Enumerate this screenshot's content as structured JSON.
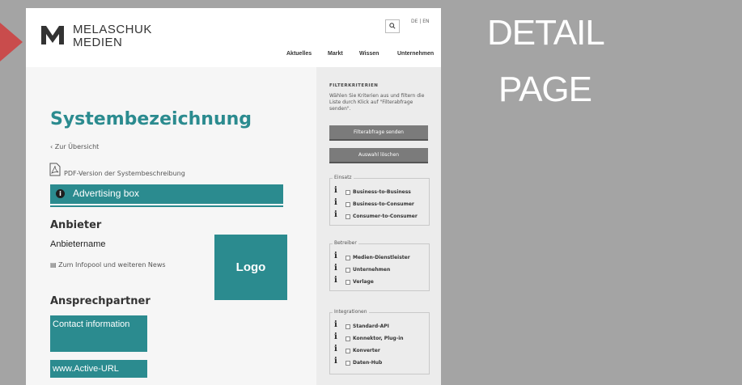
{
  "header": {
    "brand_line1": "MELASCHUK",
    "brand_line2": "MEDIEN",
    "search_icon": "search-icon",
    "languages": "DE | EN",
    "nav": [
      "Aktuelles",
      "Markt",
      "Wissen",
      "Unternehmen"
    ]
  },
  "main": {
    "title": "Systembezeichnung",
    "back_link": "Zur Übersicht",
    "pdf_link": "PDF-Version der Systembeschreibung",
    "advertising_box": "Advertising box",
    "anbieter_heading": "Anbieter",
    "anbieter_name": "Anbietername",
    "infopool_link": "Zum Infopool und weiteren News",
    "logo_placeholder": "Logo",
    "ansprech_heading": "Ansprechpartner",
    "contact_info": "Contact information",
    "active_url": "www.Active-URL"
  },
  "sidebar": {
    "filter_title": "FILTERKRITERIEN",
    "filter_desc": "Wählen Sie Kriterien aus und filtern die Liste durch Klick auf \"Filterabfrage senden\".",
    "send_button": "Filterabfrage senden",
    "clear_button": "Auswahl löschen",
    "groups": [
      {
        "legend": "Einsatz",
        "options": [
          "Business-to-Business",
          "Business-to-Consumer",
          "Consumer-to-Consumer"
        ]
      },
      {
        "legend": "Betreiber",
        "options": [
          "Medien-Dienstleister",
          "Unternehmen",
          "Verlage"
        ]
      },
      {
        "legend": "Integrationen",
        "options": [
          "Standard-API",
          "Konnektor, Plug-in",
          "Konverter",
          "Daten-Hub"
        ]
      }
    ]
  },
  "annotation": {
    "line1": "DETAIL",
    "line2": "PAGE",
    "arrow_color": "#c94c4c"
  },
  "colors": {
    "accent": "#2b8b8f",
    "background": "#a4a4a4"
  }
}
